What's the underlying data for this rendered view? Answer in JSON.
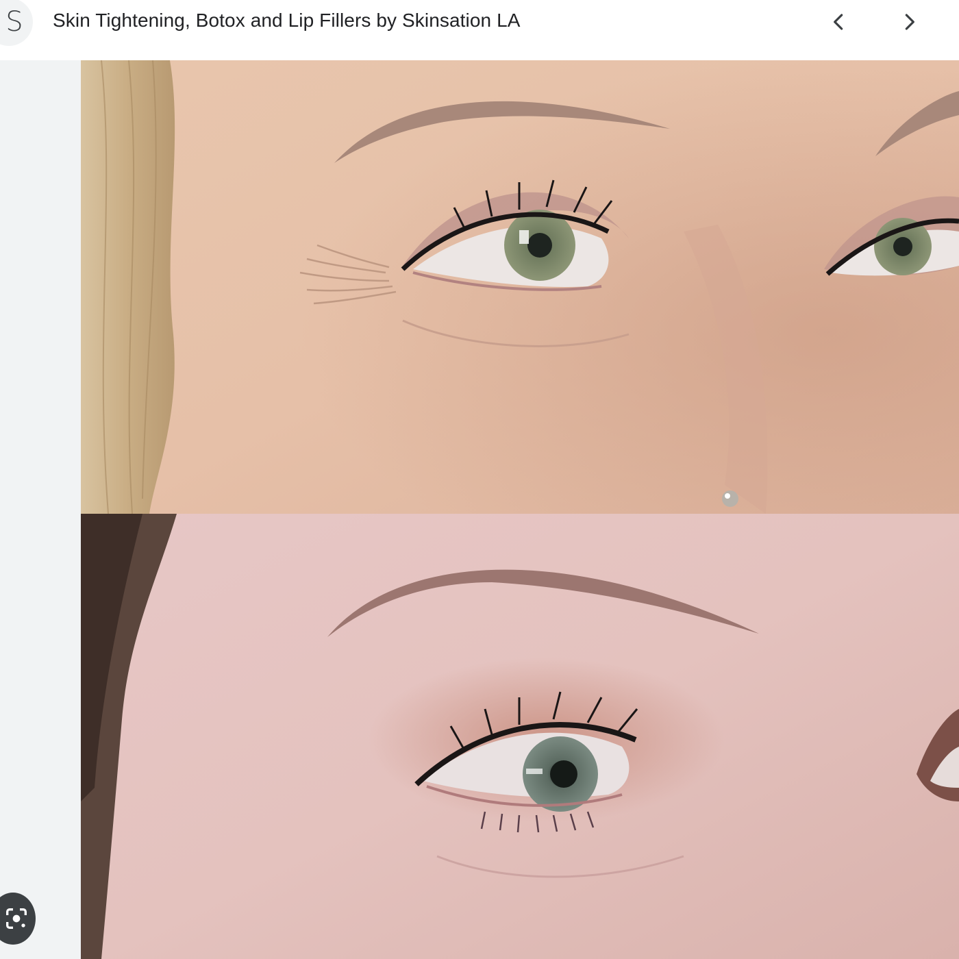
{
  "header": {
    "site_initial": "S",
    "title": "Skin Tightening, Botox and Lip Fillers by Skinsation LA",
    "prev_icon": "chevron-left-icon",
    "next_icon": "chevron-right-icon"
  },
  "sidebar": {
    "lens_icon": "google-lens-icon"
  },
  "images": {
    "before_description_icon": "before-photo",
    "after_description_icon": "after-photo"
  },
  "colors": {
    "header_bg": "#ffffff",
    "page_bg": "#f1f3f4",
    "title_text": "#202124",
    "icon_dark": "#3c4043"
  }
}
